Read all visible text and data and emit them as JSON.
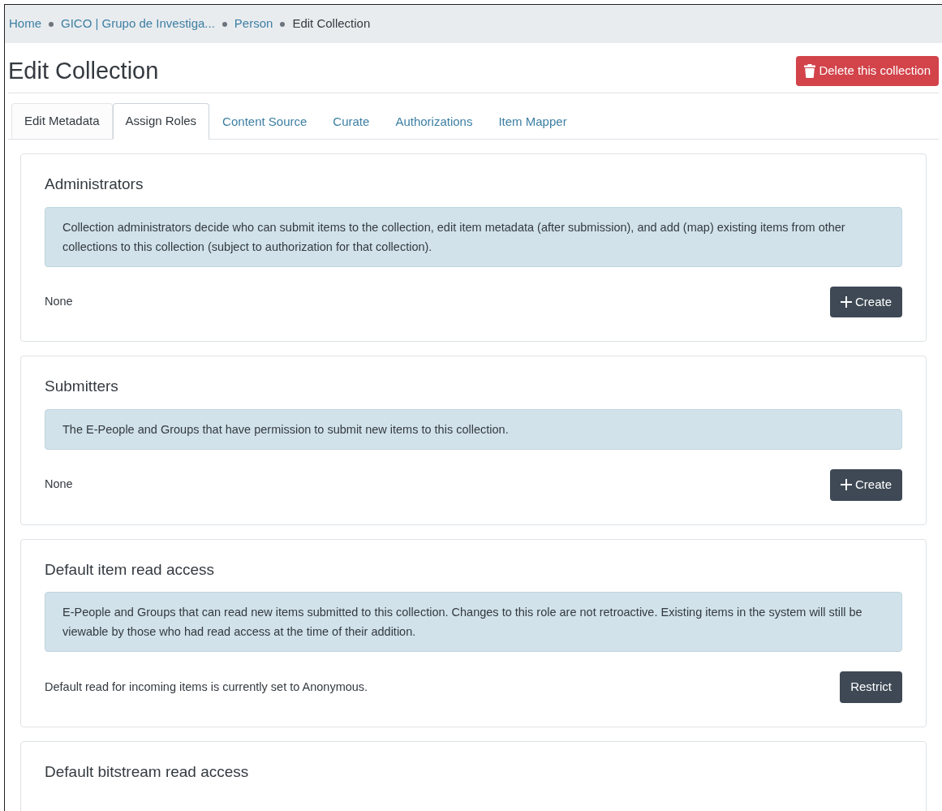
{
  "breadcrumb": [
    {
      "label": "Home",
      "current": false
    },
    {
      "label": "GICO | Grupo de Investiga...",
      "current": false
    },
    {
      "label": "Person",
      "current": false
    },
    {
      "label": "Edit Collection",
      "current": true
    }
  ],
  "title": "Edit Collection",
  "delete_button": {
    "label": "Delete this collection"
  },
  "tabs": [
    {
      "label": "Edit Metadata",
      "selected": false,
      "kind": "boxed"
    },
    {
      "label": "Assign Roles",
      "selected": true,
      "kind": "boxed"
    },
    {
      "label": "Content Source",
      "selected": false,
      "kind": "link"
    },
    {
      "label": "Curate",
      "selected": false,
      "kind": "link"
    },
    {
      "label": "Authorizations",
      "selected": false,
      "kind": "link"
    },
    {
      "label": "Item Mapper",
      "selected": false,
      "kind": "link"
    }
  ],
  "roles": [
    {
      "title": "Administrators",
      "info": "Collection administrators decide who can submit items to the collection, edit item metadata (after submission), and add (map) existing items from other collections to this collection (subject to authorization for that collection).",
      "status": "None",
      "button": {
        "kind": "create",
        "label": "Create"
      }
    },
    {
      "title": "Submitters",
      "info": "The E-People and Groups that have permission to submit new items to this collection.",
      "status": "None",
      "button": {
        "kind": "create",
        "label": "Create"
      }
    },
    {
      "title": "Default item read access",
      "info": "E-People and Groups that can read new items submitted to this collection. Changes to this role are not retroactive. Existing items in the system will still be viewable by those who had read access at the time of their addition.",
      "status": "Default read for incoming items is currently set to Anonymous.",
      "button": {
        "kind": "restrict",
        "label": "Restrict"
      }
    },
    {
      "title": "Default bitstream read access"
    }
  ]
}
